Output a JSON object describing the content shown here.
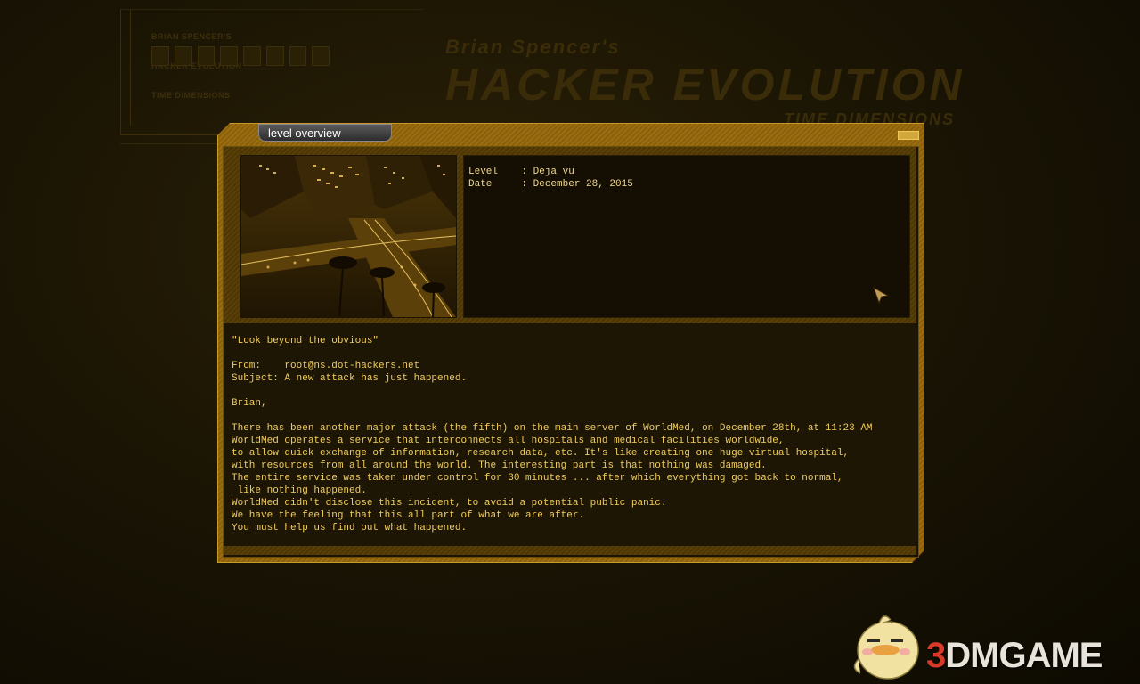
{
  "background": {
    "small_title_lines": [
      "BRIAN SPENCER'S",
      "HACKER EVOLUTION",
      "TIME DIMENSIONS"
    ],
    "big_title_line1": "Brian Spencer's",
    "big_title_line2": "HACKER EVOLUTION",
    "big_title_line3": "TIME DIMENSIONS"
  },
  "dialog": {
    "title": "level overview",
    "info": {
      "level_row": "Level    : Deja vu",
      "date_row": "Date     : December 28, 2015"
    },
    "message_lines": [
      "\"Look beyond the obvious\"",
      "",
      "From:    root@ns.dot-hackers.net",
      "Subject: A new attack has just happened.",
      "",
      "Brian,",
      "",
      "There has been another major attack (the fifth) on the main server of WorldMed, on December 28th, at 11:23 AM",
      "WorldMed operates a service that interconnects all hospitals and medical facilities worldwide,",
      "to allow quick exchange of information, research data, etc. It's like creating one huge virtual hospital,",
      "with resources from all around the world. The interesting part is that nothing was damaged.",
      "The entire service was taken under control for 30 minutes ... after which everything got back to normal,",
      " like nothing happened.",
      "WorldMed didn't disclose this incident, to avoid a potential public panic.",
      "We have the feeling that this all part of what we are after.",
      "You must help us find out what happened."
    ]
  },
  "watermark": {
    "digit": "3",
    "text": "DMGAME"
  },
  "colors": {
    "accent_gold": "#9b6d10",
    "message_text": "#f2cd5c",
    "info_text": "#f4d98c"
  }
}
